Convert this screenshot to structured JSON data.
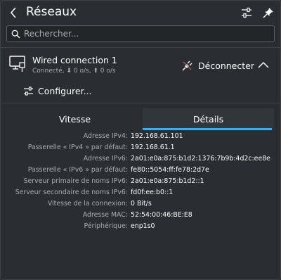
{
  "header": {
    "title": "Réseaux",
    "back_icon": "chevron-left-icon",
    "settings_icon": "configure-sliders-icon",
    "pin_icon": "pin-icon"
  },
  "search": {
    "placeholder": "Rechercher...",
    "value": ""
  },
  "connection": {
    "name": "Wired connection 1",
    "status": "Connecté, ⬇ 0 o/s, ⬆ 0 o/s",
    "disconnect_label": "Déconnecter",
    "configure_label": "Configurer..."
  },
  "tabs": [
    {
      "label": "Vitesse",
      "active": false
    },
    {
      "label": "Détails",
      "active": true
    }
  ],
  "details": [
    {
      "label": "Adresse IPv4:",
      "value": "192.168.61.101"
    },
    {
      "label": "Passerelle « IPv4 » par défaut:",
      "value": "192.168.61.1"
    },
    {
      "label": "Adresse IPv6:",
      "value": "2a01:e0a:875:b1d2:1376:7b9b:4d2c:ee8e"
    },
    {
      "label": "Passerelle « IPv6 » par défaut:",
      "value": "fe80::5054:ff:fe78:2d7e"
    },
    {
      "label": "Serveur primaire de noms IPv6:",
      "value": "2a01:e0a:875:b1d2::1"
    },
    {
      "label": "Serveur secondaire de noms IPv6:",
      "value": "fd0f:ee:b0::1"
    },
    {
      "label": "Vitesse de la connexion:",
      "value": "0 Bit/s"
    },
    {
      "label": "Adresse MAC:",
      "value": "52:54:00:46:BE:E8"
    },
    {
      "label": "Périphérique:",
      "value": "enp1s0"
    }
  ],
  "colors": {
    "background": "#2a2e32",
    "accent": "#3daee9",
    "text": "#fcfcfc",
    "muted_text": "#a8acb0"
  }
}
